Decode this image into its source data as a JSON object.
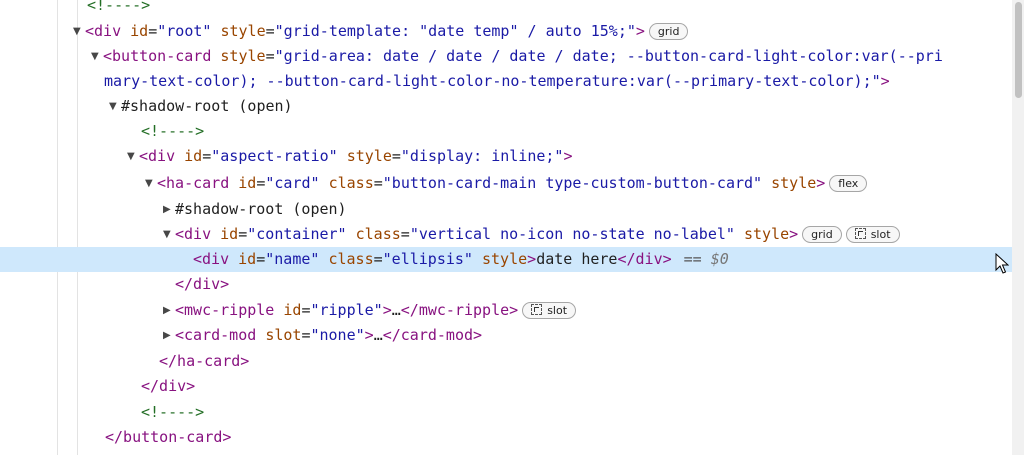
{
  "tree": {
    "l0_comment": "<!---->",
    "l1": {
      "open": "<",
      "tag": "div",
      "a1": "id",
      "eq": "=",
      "v1": "\"root\"",
      "a2": "style",
      "v2": "\"grid-template: \"date temp\" / auto 15%;\"",
      "close": ">",
      "badge": "grid"
    },
    "l2": {
      "open": "<",
      "tag": "button-card",
      "a1": "style",
      "eq": "=",
      "v1": "\"grid-area: date / date / date / date; --button-card-light-color:var(--pri"
    },
    "l3": {
      "v": "mary-text-color); --button-card-light-color-no-temperature:var(--primary-text-color);\"",
      "close": ">"
    },
    "l4": {
      "text": "#shadow-root (open)"
    },
    "l5_comment": "<!---->",
    "l6": {
      "open": "<",
      "tag": "div",
      "a1": "id",
      "eq": "=",
      "v1": "\"aspect-ratio\"",
      "a2": "style",
      "v2": "\"display: inline;\"",
      "close": ">"
    },
    "l7": {
      "open": "<",
      "tag": "ha-card",
      "a1": "id",
      "eq": "=",
      "v1": "\"card\"",
      "a2": "class",
      "v2": "\"button-card-main type-custom-button-card\"",
      "a3": "style",
      "close": ">",
      "badge": "flex"
    },
    "l8": {
      "text": "#shadow-root (open)"
    },
    "l9": {
      "open": "<",
      "tag": "div",
      "a1": "id",
      "eq": "=",
      "v1": "\"container\"",
      "a2": "class",
      "v2": "\"vertical no-icon no-state no-label\"",
      "a3": "style",
      "close": ">",
      "badge1": "grid",
      "badge2": "slot"
    },
    "l10": {
      "open": "<",
      "tag": "div",
      "a1": "id",
      "eq": "=",
      "v1": "\"name\"",
      "a2": "class",
      "v2": "\"ellipsis\"",
      "a3": "style",
      "close": ">",
      "text": "date here",
      "end": "</div>",
      "eqsign": "==",
      "dollar": "$0"
    },
    "l11": {
      "text": "</div>"
    },
    "l12": {
      "open": "<",
      "tag": "mwc-ripple",
      "a1": "id",
      "eq": "=",
      "v1": "\"ripple\"",
      "close": ">",
      "ellipsis": "…",
      "end": "</mwc-ripple>",
      "badge": "slot"
    },
    "l13": {
      "open": "<",
      "tag": "card-mod",
      "a1": "slot",
      "eq": "=",
      "v1": "\"none\"",
      "close": ">",
      "ellipsis": "…",
      "end": "</card-mod>"
    },
    "l14": {
      "text": "</ha-card>"
    },
    "l15": {
      "text": "</div>"
    },
    "l16_comment": "<!---->",
    "l17": {
      "text": "</button-card>"
    }
  },
  "icons": {
    "expand": "triangle-down-icon",
    "collapse": "triangle-right-icon",
    "slot": "slot-reveal-icon",
    "cursor": "mouse-pointer-icon"
  },
  "colors": {
    "tag": "#881280",
    "attr": "#994500",
    "value": "#1a1aa6",
    "comment": "#236e25",
    "selection": "#cfe8fc"
  }
}
